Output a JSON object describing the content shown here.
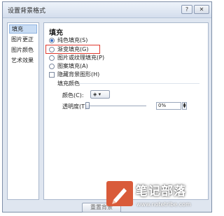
{
  "window": {
    "title": "设置背景格式",
    "help_glyph": "?",
    "close_glyph": "✕"
  },
  "sidebar": {
    "items": [
      {
        "label": "填充",
        "active": true
      },
      {
        "label": "图片更正",
        "active": false
      },
      {
        "label": "图片颜色",
        "active": false
      },
      {
        "label": "艺术效果",
        "active": false
      }
    ]
  },
  "main": {
    "section_title": "填充",
    "options": [
      {
        "label": "纯色填充(S)",
        "type": "radio",
        "checked": true
      },
      {
        "label": "渐变填充(G)",
        "type": "radio",
        "checked": false,
        "highlighted": true
      },
      {
        "label": "图片或纹理填充(P)",
        "type": "radio",
        "checked": false
      },
      {
        "label": "图案填充(A)",
        "type": "radio",
        "checked": false
      },
      {
        "label": "隐藏背景图形(H)",
        "type": "checkbox",
        "checked": false
      }
    ],
    "fill_color_title": "填充颜色",
    "color_label": "颜色(C):",
    "transparency_label": "透明度(T):",
    "transparency_value": "0%",
    "transparency_level": 0
  },
  "footer": {
    "reset_button": "重置背景"
  },
  "watermark": {
    "title": "笔记部落",
    "url": "www.notetribe.com"
  },
  "colors": {
    "highlight": "#e03a2f",
    "watermark_brand": "#d95b3a"
  }
}
